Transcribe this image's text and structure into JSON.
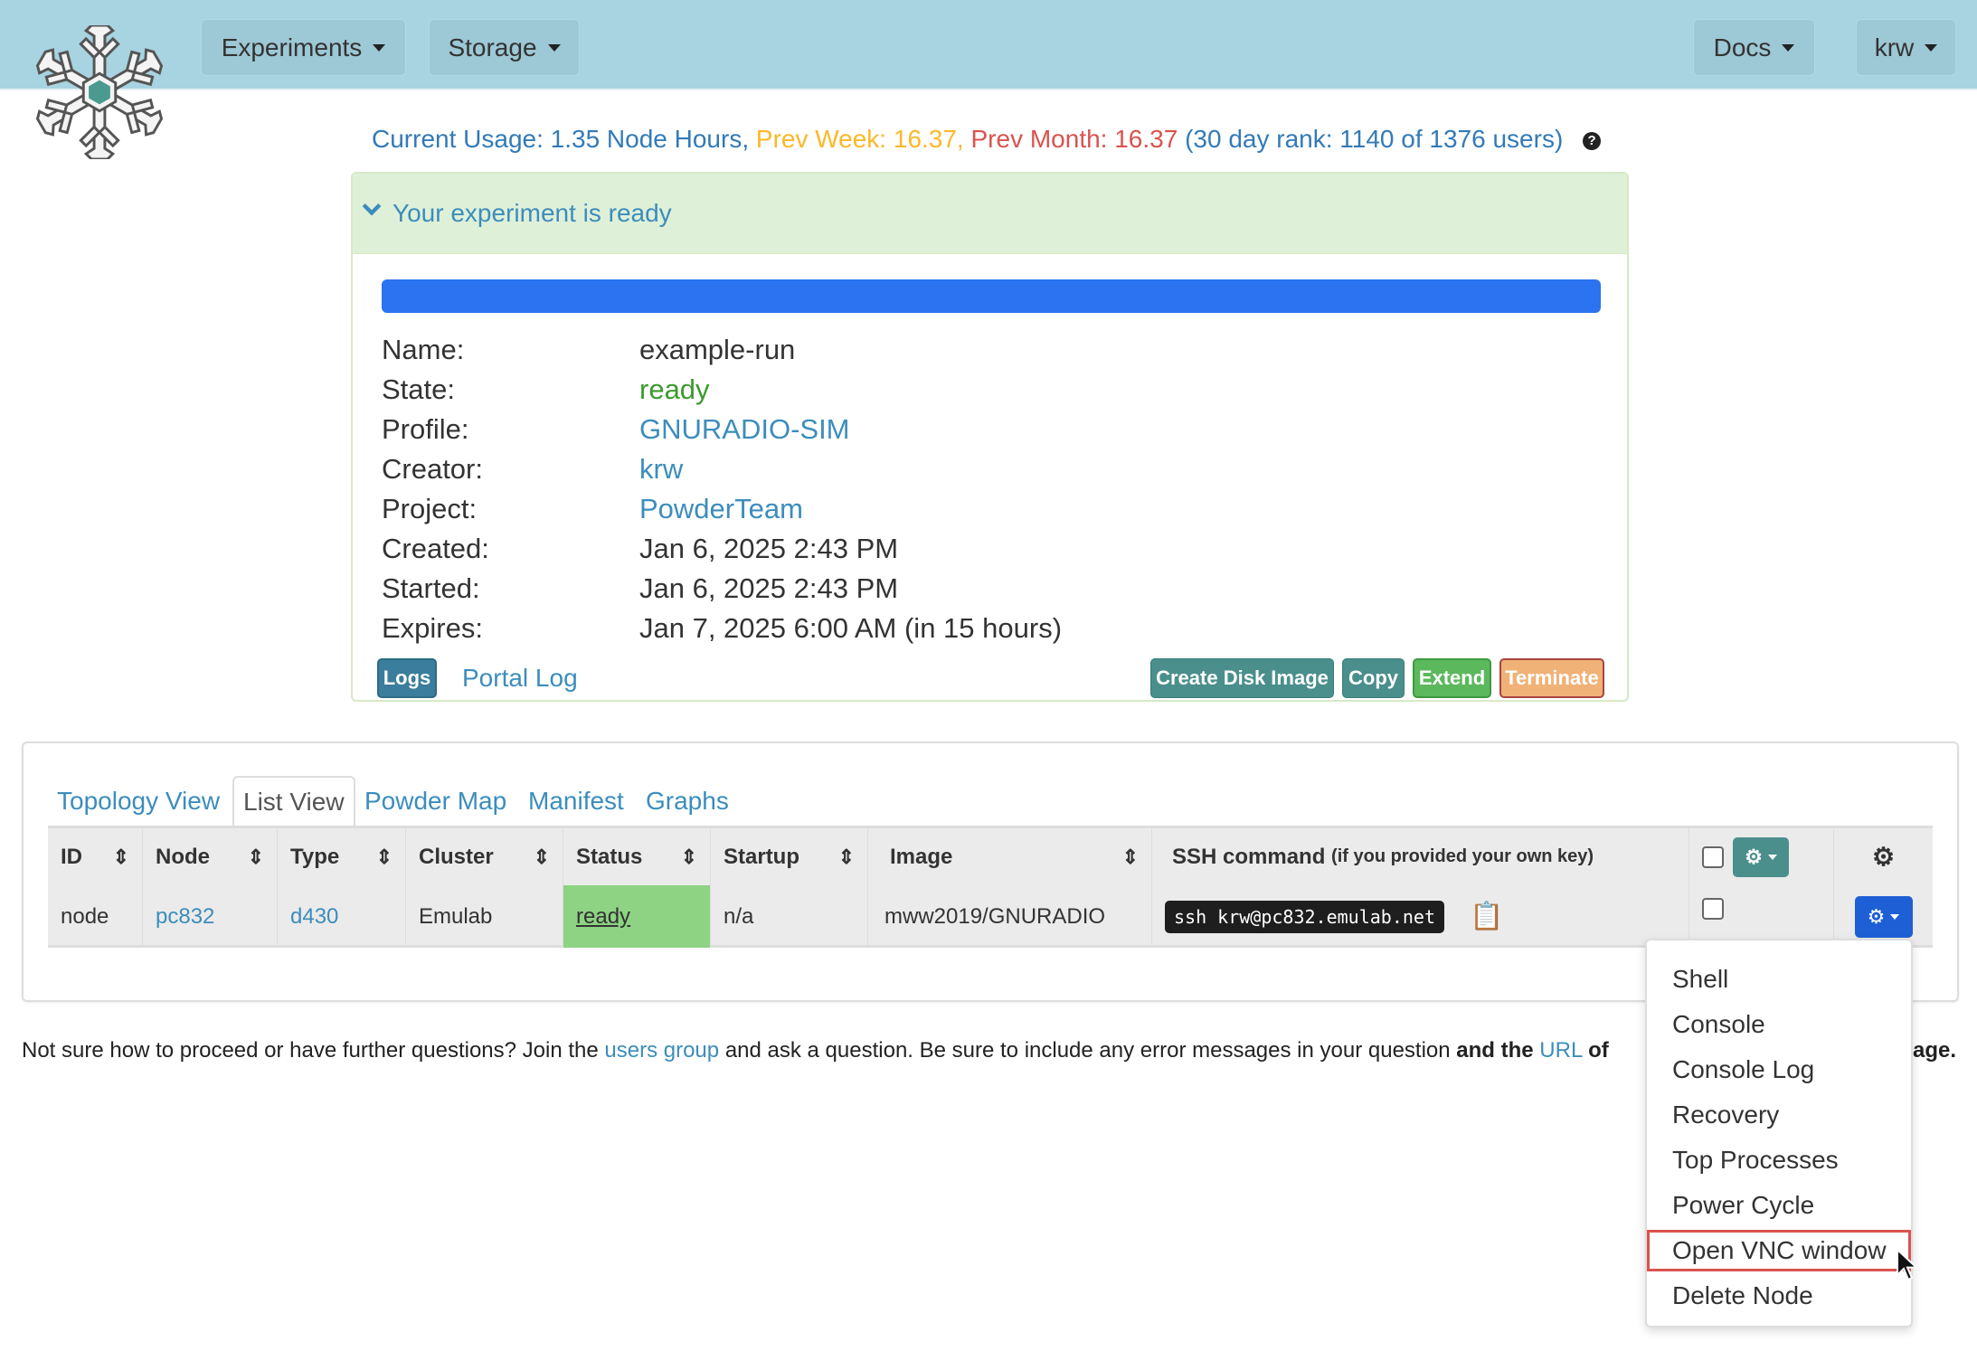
{
  "navbar": {
    "menus": [
      {
        "label": "Experiments"
      },
      {
        "label": "Storage"
      },
      {
        "label": "Docs"
      },
      {
        "label": "krw"
      }
    ]
  },
  "usage": {
    "current": "Current Usage: 1.35 Node Hours,",
    "prev_week": "Prev Week: 16.37,",
    "prev_month": "Prev Month: 16.37",
    "rank": "(30 day rank: 1140 of 1376 users)"
  },
  "status_panel": {
    "heading": "Your experiment is ready",
    "progress_percent": 100,
    "details": [
      {
        "label": "Name:",
        "value": "example-run"
      },
      {
        "label": "State:",
        "value": "ready"
      },
      {
        "label": "Profile:",
        "value": "GNURADIO-SIM"
      },
      {
        "label": "Creator:",
        "value": "krw"
      },
      {
        "label": "Project:",
        "value": "PowderTeam"
      },
      {
        "label": "Created:",
        "value": "Jan 6, 2025 2:43 PM"
      },
      {
        "label": "Started:",
        "value": "Jan 6, 2025 2:43 PM"
      },
      {
        "label": "Expires:",
        "value": "Jan 7, 2025 6:00 AM (in 15 hours)"
      }
    ],
    "logs_label": "Logs",
    "portal_log_label": "Portal Log",
    "buttons": {
      "create_disk_image": "Create Disk Image",
      "copy": "Copy",
      "extend": "Extend",
      "terminate": "Terminate"
    }
  },
  "tabs": [
    {
      "label": "Topology View"
    },
    {
      "label": "List View",
      "active": true
    },
    {
      "label": "Powder Map"
    },
    {
      "label": "Manifest"
    },
    {
      "label": "Graphs"
    }
  ],
  "table": {
    "headers": [
      "ID",
      "Node",
      "Type",
      "Cluster",
      "Status",
      "Startup",
      "Image",
      "SSH command",
      "(if you provided your own key)"
    ],
    "rows": [
      {
        "id": "node",
        "node": "pc832",
        "type": "d430",
        "cluster": "Emulab",
        "status": "ready",
        "startup": "n/a",
        "image": "mww2019/GNURADIO",
        "ssh": "ssh krw@pc832.emulab.net"
      }
    ]
  },
  "footer": {
    "text1": "Not sure how to proceed or have further questions? Join the",
    "link1": "users group",
    "text2": "and ask a question. Be sure to include any error messages in your question",
    "bold1": "and the",
    "link2": "URL",
    "text3": "of",
    "tail": "age."
  },
  "node_menu": {
    "items": [
      "Shell",
      "Console",
      "Console Log",
      "Recovery",
      "Top Processes",
      "Power Cycle",
      "Open VNC window",
      "Delete Node"
    ],
    "highlighted": "Open VNC window"
  },
  "colors": {
    "navbar": "#a8d3e0",
    "progress": "#2b73f0",
    "status_ready": "#8dd383",
    "teal_button": "#4a8f8c",
    "extend": "#5cb85c",
    "terminate": "#f0ad4e",
    "node_action": "#1f5fd6"
  }
}
